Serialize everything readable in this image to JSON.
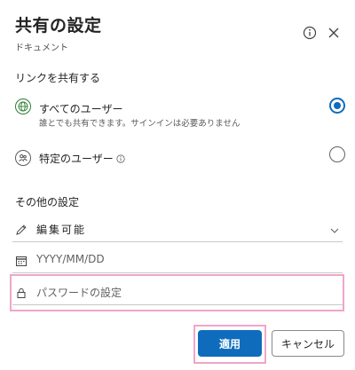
{
  "dialog": {
    "title": "共有の設定",
    "subtitle": "ドキュメント"
  },
  "link_section": {
    "label": "リンクを共有する",
    "options": [
      {
        "title": "すべてのユーザー",
        "description": "誰とでも共有できます。サインインは必要ありません",
        "selected": true
      },
      {
        "title": "特定のユーザー",
        "selected": false
      }
    ]
  },
  "other_section": {
    "label": "その他の設定",
    "permission": {
      "value": "編集可能"
    },
    "expiry": {
      "placeholder": "YYYY/MM/DD"
    },
    "password": {
      "placeholder": "パスワードの設定"
    }
  },
  "buttons": {
    "apply": "適用",
    "cancel": "キャンセル"
  },
  "colors": {
    "accent": "#0f6cbd",
    "highlight": "#f0a6c8",
    "globe": "#2e7d32"
  }
}
